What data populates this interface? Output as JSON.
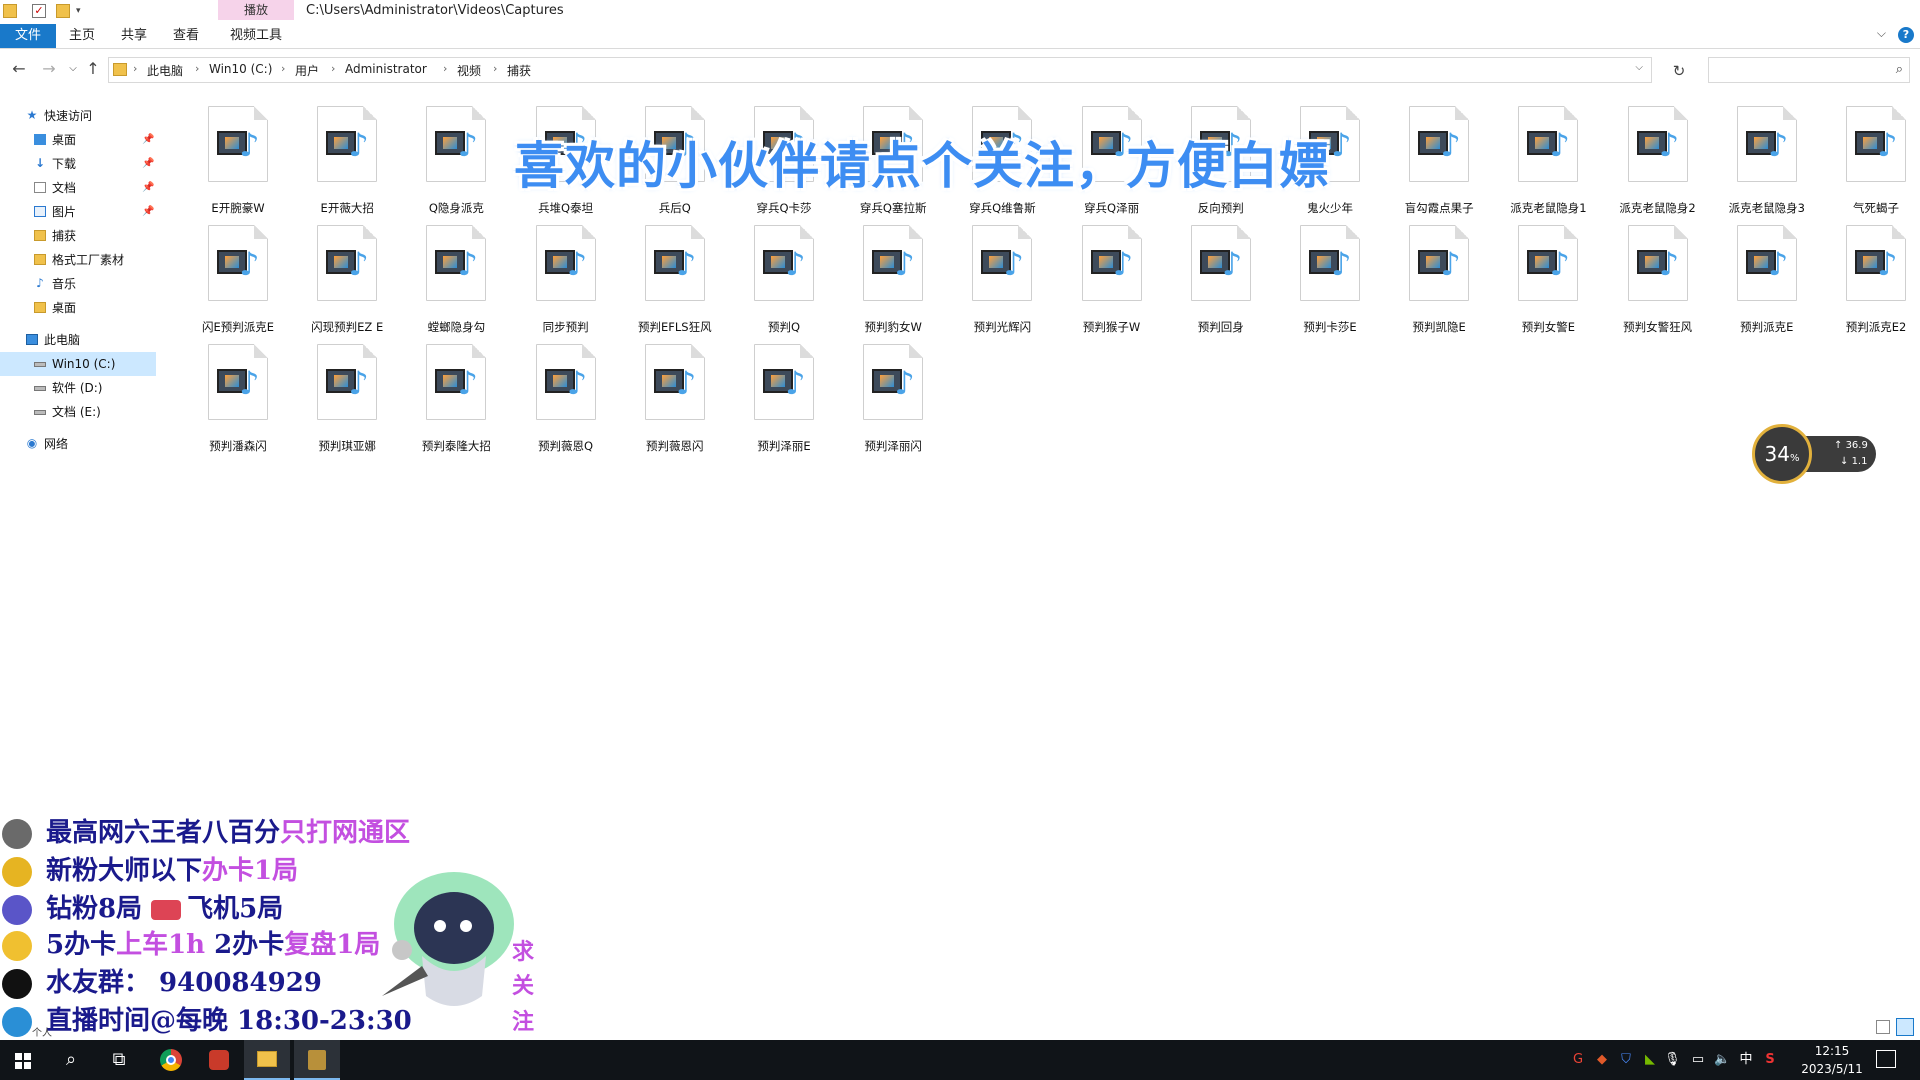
{
  "window": {
    "path_title": "C:\\Users\\Administrator\\Videos\\Captures",
    "context_tab": "播放"
  },
  "ribbon": {
    "tabs": [
      "文件",
      "主页",
      "共享",
      "查看",
      "视频工具"
    ]
  },
  "address": {
    "crumbs": [
      "此电脑",
      "Win10 (C:)",
      "用户",
      "Administrator",
      "视频",
      "捕获"
    ],
    "search_placeholder": ""
  },
  "sidebar": {
    "items": [
      {
        "label": "快速访问",
        "icon": "star-icon",
        "pinned": false
      },
      {
        "label": "桌面",
        "icon": "desktop-icon",
        "pinned": true
      },
      {
        "label": "下载",
        "icon": "download-icon",
        "pinned": true
      },
      {
        "label": "文档",
        "icon": "document-icon",
        "pinned": true
      },
      {
        "label": "图片",
        "icon": "pictures-icon",
        "pinned": true
      },
      {
        "label": "捕获",
        "icon": "folder-icon",
        "pinned": false
      },
      {
        "label": "格式工厂素材",
        "icon": "folder-icon",
        "pinned": false
      },
      {
        "label": "音乐",
        "icon": "music-icon",
        "pinned": false
      },
      {
        "label": "桌面",
        "icon": "folder-icon",
        "pinned": false
      },
      {
        "label": "此电脑",
        "icon": "pc-icon",
        "pinned": false
      },
      {
        "label": "Win10 (C:)",
        "icon": "drive-icon",
        "pinned": false,
        "selected": true
      },
      {
        "label": "软件 (D:)",
        "icon": "drive-icon",
        "pinned": false
      },
      {
        "label": "文档 (E:)",
        "icon": "drive-icon",
        "pinned": false
      },
      {
        "label": "网络",
        "icon": "network-icon",
        "pinned": false
      }
    ]
  },
  "files": [
    "E开腕豪W",
    "E开薇大招",
    "Q隐身派克",
    "兵堆Q泰坦",
    "兵后Q",
    "穿兵Q卡莎",
    "穿兵Q塞拉斯",
    "穿兵Q维鲁斯",
    "穿兵Q泽丽",
    "反向预判",
    "鬼火少年",
    "盲勾霞点果子",
    "派克老鼠隐身1",
    "派克老鼠隐身2",
    "派克老鼠隐身3",
    "气死蝎子",
    "闪E预判派克E",
    "闪现预判EZ  E",
    "螳螂隐身勾",
    "同步预判",
    "预判EFLS狂风",
    "预判Q",
    "预判豹女W",
    "预判光辉闪",
    "预判猴子W",
    "预判回身",
    "预判卡莎E",
    "预判凯隐E",
    "预判女警E",
    "预判女警狂风",
    "预判派克E",
    "预判派克E2",
    "预判潘森闪",
    "预判琪亚娜",
    "预判泰隆大招",
    "预判薇恩Q",
    "预判薇恩闪",
    "预判泽丽E",
    "预判泽丽闪"
  ],
  "overlay": {
    "banner": "喜欢的小伙伴请点个关注，方便白嫖",
    "meter_percent": "34",
    "meter_percent_unit": "%",
    "meter_up": "36.9",
    "meter_down": "1.1",
    "promo_lines": [
      {
        "text": "最高网六王者八百分",
        "highlight": "只打网通区",
        "icon_color": "#6a6a6a"
      },
      {
        "text": "新粉大师以下",
        "highlight": "办卡1局",
        "icon_color": "#e6b422"
      },
      {
        "text": "钻粉8局 ",
        "extra": "飞机5局",
        "icon_color": "#5a55c8"
      },
      {
        "text": "5办卡",
        "highlight": "上车1h",
        "text2": " 2办卡",
        "highlight2": "复盘1局",
        "icon_color": "#f0c030"
      },
      {
        "text": "水友群：  940084929",
        "icon_color": "#111111"
      },
      {
        "text": "直播时间@每晚 18:30-23:30",
        "icon_color": "#2a8fd6"
      }
    ],
    "side_chars": [
      "求",
      "关",
      "注"
    ],
    "stray": "个人"
  },
  "taskbar": {
    "time": "12:15",
    "date": "2023/5/11",
    "ime": "中"
  }
}
